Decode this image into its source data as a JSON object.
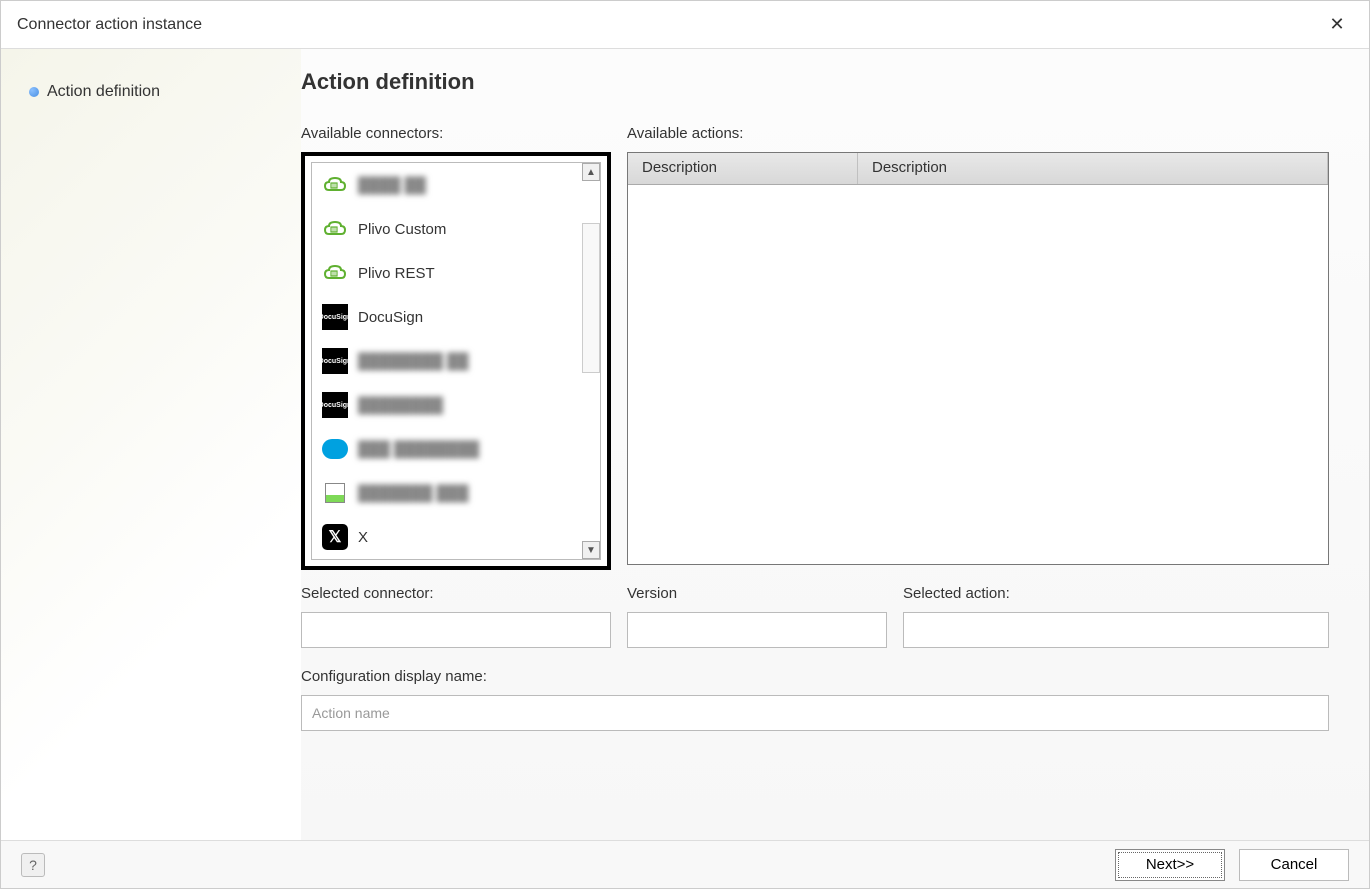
{
  "titlebar": {
    "title": "Connector action instance"
  },
  "sidebar": {
    "items": [
      {
        "label": "Action definition"
      }
    ]
  },
  "main": {
    "heading": "Action definition",
    "available_connectors_label": "Available connectors:",
    "available_actions_label": "Available actions:",
    "connectors": [
      {
        "label": "████ ██",
        "icon": "cloud-green",
        "blurred": true
      },
      {
        "label": "Plivo Custom",
        "icon": "cloud-green",
        "blurred": false
      },
      {
        "label": "Plivo REST",
        "icon": "cloud-green",
        "blurred": false
      },
      {
        "label": "DocuSign",
        "icon": "docusign",
        "blurred": false
      },
      {
        "label": "████████ ██",
        "icon": "docusign",
        "blurred": true
      },
      {
        "label": "████████",
        "icon": "docusign",
        "blurred": true
      },
      {
        "label": "███ ████████",
        "icon": "salesforce",
        "blurred": true
      },
      {
        "label": "███████ ███",
        "icon": "image",
        "blurred": true
      },
      {
        "label": "X",
        "icon": "x-logo",
        "blurred": false
      }
    ],
    "actions_table": {
      "columns": [
        "Description",
        "Description"
      ]
    },
    "fields": {
      "selected_connector_label": "Selected connector:",
      "selected_connector_value": "",
      "version_label": "Version",
      "version_value": "",
      "selected_action_label": "Selected action:",
      "selected_action_value": "",
      "config_display_label": "Configuration display name:",
      "config_display_placeholder": "Action name",
      "config_display_value": ""
    }
  },
  "footer": {
    "next_label": "Next>>",
    "cancel_label": "Cancel"
  }
}
